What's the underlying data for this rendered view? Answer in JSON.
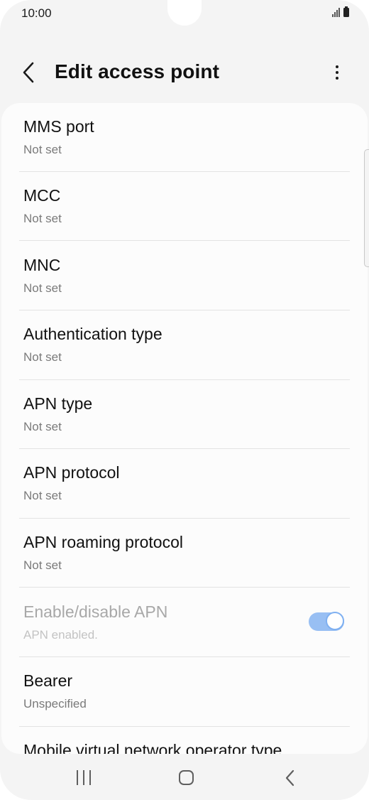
{
  "status_bar": {
    "time": "10:00"
  },
  "header": {
    "title": "Edit access point",
    "back_icon": "chevron-left-icon",
    "more_icon": "more-vertical-icon"
  },
  "items": [
    {
      "title": "MMS port",
      "subtitle": "Not set"
    },
    {
      "title": "MCC",
      "subtitle": "Not set"
    },
    {
      "title": "MNC",
      "subtitle": "Not set"
    },
    {
      "title": "Authentication type",
      "subtitle": "Not set"
    },
    {
      "title": "APN type",
      "subtitle": "Not set"
    },
    {
      "title": "APN protocol",
      "subtitle": "Not set"
    },
    {
      "title": "APN roaming protocol",
      "subtitle": "Not set"
    },
    {
      "title": "Enable/disable APN",
      "subtitle": "APN enabled.",
      "toggle_on": true,
      "disabled": true
    },
    {
      "title": "Bearer",
      "subtitle": "Unspecified"
    },
    {
      "title": "Mobile virtual network operator type"
    }
  ],
  "colors": {
    "toggle_track": "#98bff3",
    "toggle_thumb_border": "#7fb0f1",
    "background": "#f4f4f4",
    "card": "#fcfcfc"
  },
  "nav_bar": {
    "recents_icon": "recent-apps-icon",
    "home_icon": "home-icon",
    "back_icon": "back-icon"
  }
}
